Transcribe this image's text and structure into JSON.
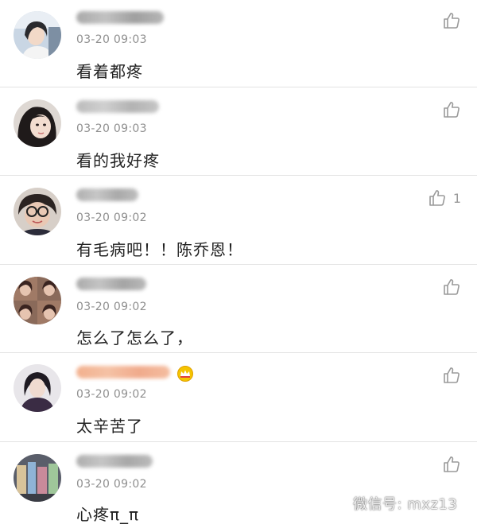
{
  "comments": [
    {
      "time": "03-20 09:03",
      "text": "看着都疼",
      "likes": ""
    },
    {
      "time": "03-20 09:03",
      "text": "看的我好疼",
      "likes": ""
    },
    {
      "time": "03-20 09:02",
      "text": "有毛病吧！！陈乔恩！",
      "likes": "1"
    },
    {
      "time": "03-20 09:02",
      "text": "怎么了怎么了，",
      "likes": ""
    },
    {
      "time": "03-20 09:02",
      "text": "太辛苦了",
      "likes": ""
    },
    {
      "time": "03-20 09:02",
      "text": "心疼π_π",
      "likes": ""
    }
  ],
  "watermark": {
    "text": "微信号: mxz13"
  },
  "icons": {
    "like": "thumbs-up-icon",
    "vip": "crown-icon",
    "wechat": "wechat-icon"
  },
  "colors": {
    "divider": "#e3e3e3",
    "time": "#8f8f8f",
    "text": "#222222",
    "icon": "#999999",
    "crown": "#f2b400"
  }
}
